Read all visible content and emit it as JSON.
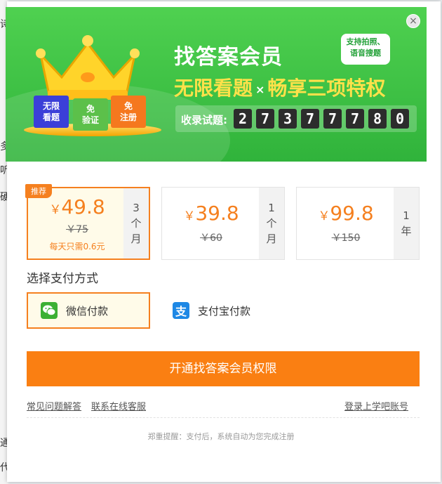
{
  "background": {
    "fragments": [
      "诗",
      "多",
      "听",
      "硬",
      "通",
      "代"
    ]
  },
  "banner": {
    "title": "找答案会员",
    "bubble": [
      "支持拍照、",
      "语音搜题"
    ],
    "subtitle_left": "无限看题",
    "subtitle_x": "×",
    "subtitle_right": "畅享三项特权",
    "tags": [
      {
        "line1": "无限",
        "line2": "看题"
      },
      {
        "line1": "免",
        "line2": "验证"
      },
      {
        "line1": "免",
        "line2": "注册"
      }
    ],
    "count_label": "收录试题:",
    "count_digits": [
      "2",
      "7",
      "3",
      "7",
      "7",
      "7",
      "8",
      "0"
    ]
  },
  "close_label": "×",
  "plans": [
    {
      "badge": "推荐",
      "price": "49.8",
      "original": "￥75",
      "daily": "每天只需0.6元",
      "duration": [
        "3",
        "个",
        "月"
      ],
      "selected": true
    },
    {
      "price": "39.8",
      "original": "￥60",
      "duration": [
        "1",
        "个",
        "月"
      ],
      "selected": false
    },
    {
      "price": "99.8",
      "original": "￥150",
      "duration": [
        "1",
        "年"
      ],
      "selected": false
    }
  ],
  "currency_symbol": "￥",
  "payment": {
    "label": "选择支付方式",
    "wechat": "微信付款",
    "alipay": "支付宝付款",
    "wechat_color": "#3cb034",
    "alipay_color": "#1e88e5"
  },
  "cta": "开通找答案会员权限",
  "links": {
    "faq": "常见问题解答",
    "service": "联系在线客服",
    "login": "登录上学吧账号"
  },
  "hint": "郑重提醒：支付后，系统自动为您完成注册",
  "colors": {
    "accent": "#fa7f12",
    "banner_green": "#30b33b"
  }
}
